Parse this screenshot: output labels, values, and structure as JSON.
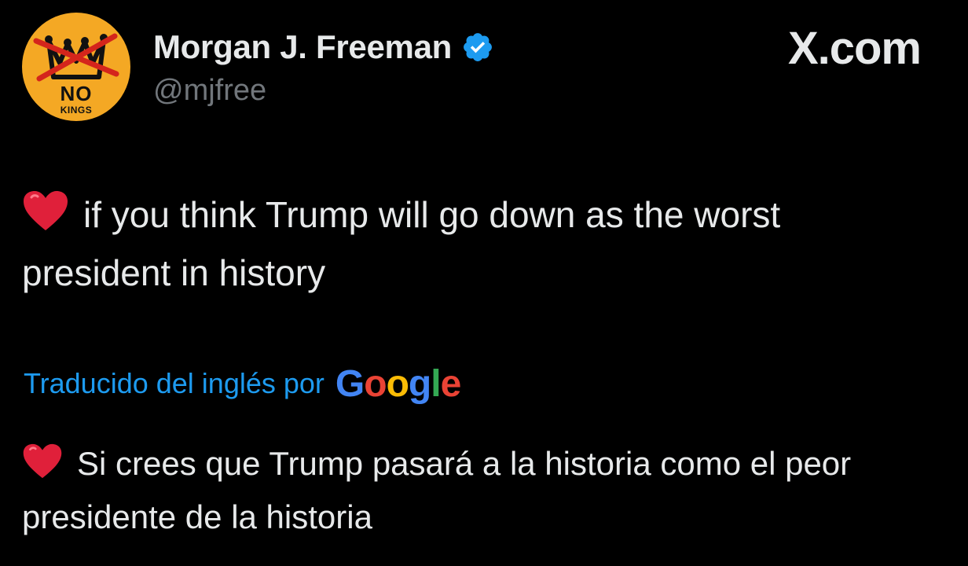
{
  "author": {
    "display_name": "Morgan J. Freeman",
    "handle": "@mjfree",
    "verified": true,
    "avatar": {
      "icon": "no-kings-crown-icon",
      "word_top": "NO",
      "word_bottom": "KINGS",
      "background_color": "#f4a824"
    }
  },
  "brand": {
    "label": "X.com"
  },
  "tweet": {
    "original_text": "if you think Trump will go down as the worst president in history",
    "original_emoji_icon": "red-heart-icon",
    "translation_label": "Traducido del inglés por",
    "translation_provider": {
      "letters": [
        "G",
        "o",
        "o",
        "g",
        "l",
        "e"
      ],
      "colors": [
        "#4285f4",
        "#ea4335",
        "#fbbc05",
        "#4285f4",
        "#34a853",
        "#ea4335"
      ]
    },
    "translated_text": "Si crees que Trump pasará a la historia como el peor presidente de la historia",
    "translated_emoji_icon": "red-heart-icon"
  },
  "colors": {
    "background": "#000000",
    "text_primary": "#e7e9ea",
    "text_secondary": "#71767b",
    "link_blue": "#1d9bf0",
    "verified_badge": "#1d9bf0",
    "heart_red": "#e0203a"
  }
}
